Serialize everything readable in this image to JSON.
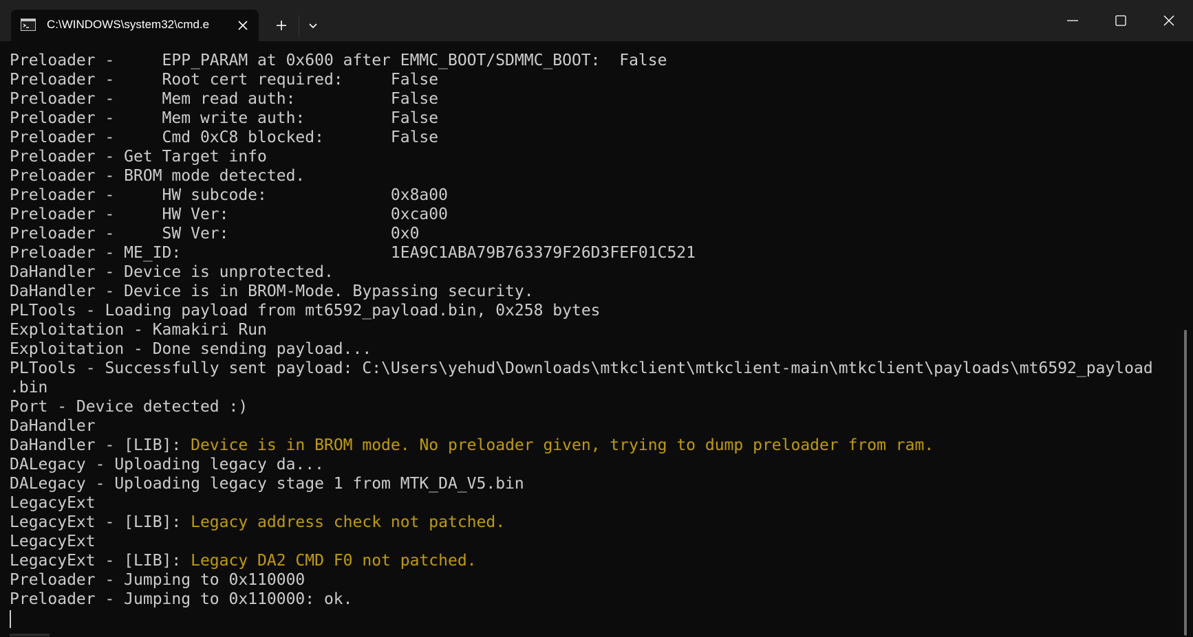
{
  "window": {
    "tab_title": "C:\\WINDOWS\\system32\\cmd.e",
    "tab_icon": "cmd-icon",
    "new_tab_icon": "plus-icon",
    "dropdown_icon": "chevron-down-icon",
    "minimize_icon": "minimize-icon",
    "maximize_icon": "maximize-icon",
    "close_icon": "close-icon"
  },
  "colors": {
    "background": "#0c0c0c",
    "titlebar": "#202020",
    "text": "#cccccc",
    "warning": "#c19c00"
  },
  "terminal": {
    "lines": [
      {
        "prefix": "Preloader -     EPP_PARAM at 0x600 after EMMC_BOOT/SDMMC_BOOT:  False",
        "highlight": ""
      },
      {
        "prefix": "Preloader -     Root cert required:     False",
        "highlight": ""
      },
      {
        "prefix": "Preloader -     Mem read auth:          False",
        "highlight": ""
      },
      {
        "prefix": "Preloader -     Mem write auth:         False",
        "highlight": ""
      },
      {
        "prefix": "Preloader -     Cmd 0xC8 blocked:       False",
        "highlight": ""
      },
      {
        "prefix": "Preloader - Get Target info",
        "highlight": ""
      },
      {
        "prefix": "Preloader - BROM mode detected.",
        "highlight": ""
      },
      {
        "prefix": "Preloader -     HW subcode:             0x8a00",
        "highlight": ""
      },
      {
        "prefix": "Preloader -     HW Ver:                 0xca00",
        "highlight": ""
      },
      {
        "prefix": "Preloader -     SW Ver:                 0x0",
        "highlight": ""
      },
      {
        "prefix": "Preloader - ME_ID:                      1EA9C1ABA79B763379F26D3FEF01C521",
        "highlight": ""
      },
      {
        "prefix": "DaHandler - Device is unprotected.",
        "highlight": ""
      },
      {
        "prefix": "DaHandler - Device is in BROM-Mode. Bypassing security.",
        "highlight": ""
      },
      {
        "prefix": "PLTools - Loading payload from mt6592_payload.bin, 0x258 bytes",
        "highlight": ""
      },
      {
        "prefix": "Exploitation - Kamakiri Run",
        "highlight": ""
      },
      {
        "prefix": "Exploitation - Done sending payload...",
        "highlight": ""
      },
      {
        "prefix": "PLTools - Successfully sent payload: C:\\Users\\yehud\\Downloads\\mtkclient\\mtkclient-main\\mtkclient\\payloads\\mt6592_payload",
        "highlight": ""
      },
      {
        "prefix": ".bin",
        "highlight": ""
      },
      {
        "prefix": "Port - Device detected :)",
        "highlight": ""
      },
      {
        "prefix": "DaHandler",
        "highlight": ""
      },
      {
        "prefix": "DaHandler - [LIB]: ",
        "highlight": "Device is in BROM mode. No preloader given, trying to dump preloader from ram."
      },
      {
        "prefix": "DALegacy - Uploading legacy da...",
        "highlight": ""
      },
      {
        "prefix": "DALegacy - Uploading legacy stage 1 from MTK_DA_V5.bin",
        "highlight": ""
      },
      {
        "prefix": "LegacyExt",
        "highlight": ""
      },
      {
        "prefix": "LegacyExt - [LIB]: ",
        "highlight": "Legacy address check not patched."
      },
      {
        "prefix": "LegacyExt",
        "highlight": ""
      },
      {
        "prefix": "LegacyExt - [LIB]: ",
        "highlight": "Legacy DA2 CMD F0 not patched."
      },
      {
        "prefix": "Preloader - Jumping to 0x110000",
        "highlight": ""
      },
      {
        "prefix": "Preloader - Jumping to 0x110000: ok.",
        "highlight": ""
      }
    ]
  }
}
